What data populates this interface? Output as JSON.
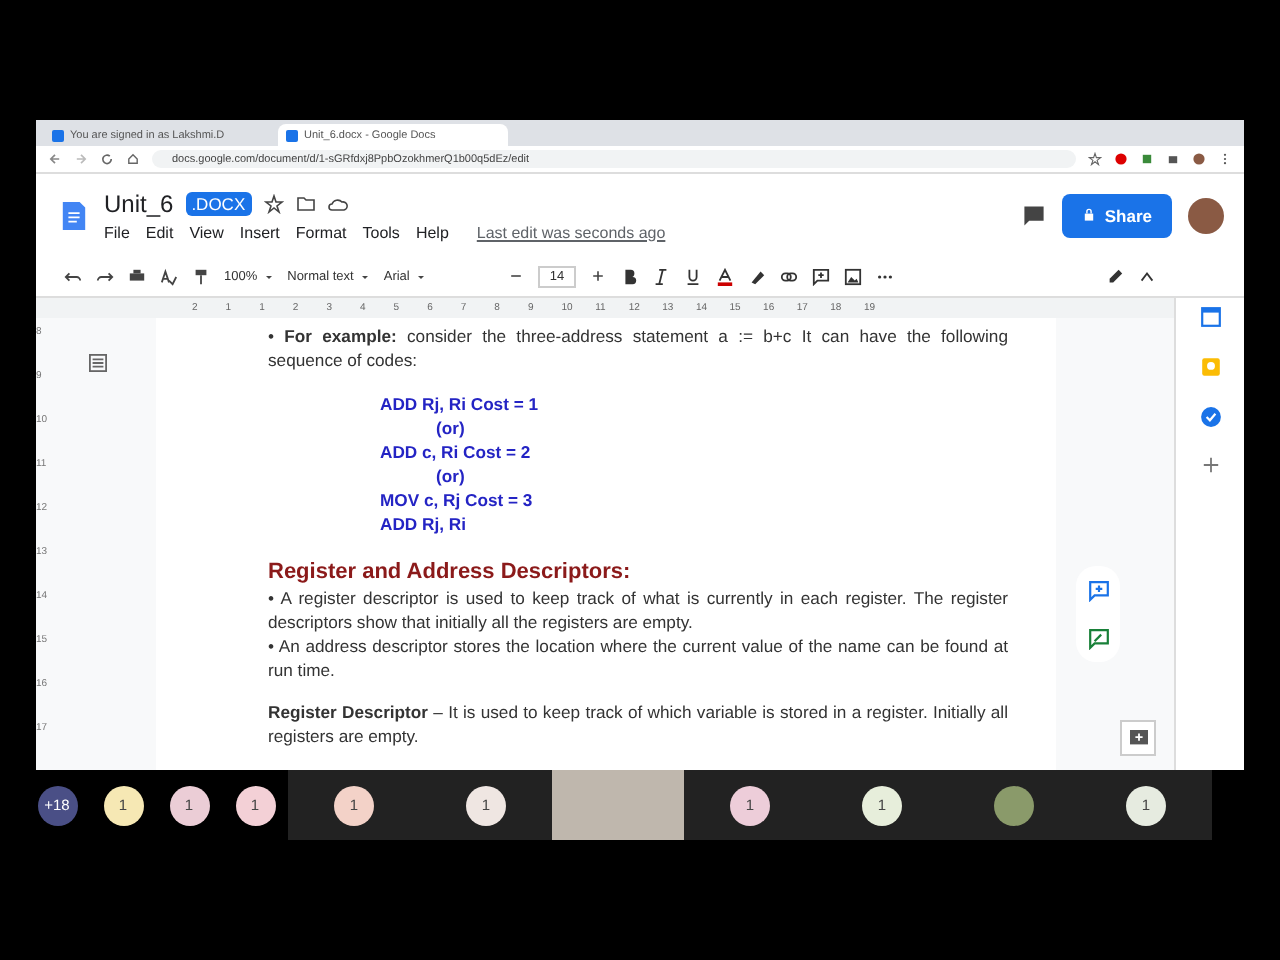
{
  "browser": {
    "tabs": [
      {
        "title": "You are signed in as Lakshmi.D",
        "selected": false
      },
      {
        "title": "Unit_6.docx - Google Docs",
        "selected": true
      }
    ],
    "url": "docs.google.com/document/d/1-sGRfdxj8PpbOzokhmerQ1b00q5dEz/edit"
  },
  "doc": {
    "title": "Unit_6",
    "badge": ".DOCX",
    "menus": [
      "File",
      "Edit",
      "View",
      "Insert",
      "Format",
      "Tools",
      "Help"
    ],
    "last_edit": "Last edit was seconds ago",
    "share": "Share"
  },
  "toolbar": {
    "zoom": "100%",
    "style": "Normal text",
    "font": "Arial",
    "size": "14"
  },
  "ruler": [
    "2",
    "1",
    "1",
    "2",
    "3",
    "4",
    "5",
    "6",
    "7",
    "8",
    "9",
    "10",
    "11",
    "12",
    "13",
    "14",
    "15",
    "16",
    "17",
    "18",
    "19"
  ],
  "vertical_ruler": [
    "8",
    "9",
    "10",
    "11",
    "12",
    "13",
    "14",
    "15",
    "16",
    "17"
  ],
  "content": [
    {
      "kind": "para",
      "text": "• **For example:** consider the three-address statement a := b+c It can have the following sequence of codes:"
    },
    {
      "kind": "code",
      "text": "ADD Rj, Ri Cost = 1",
      "indent": false
    },
    {
      "kind": "code",
      "text": "(or)",
      "indent": true
    },
    {
      "kind": "code",
      "text": "ADD c, Ri Cost = 2",
      "indent": false
    },
    {
      "kind": "code",
      "text": "(or)",
      "indent": true
    },
    {
      "kind": "code",
      "text": "MOV c, Rj Cost = 3",
      "indent": false
    },
    {
      "kind": "code",
      "text": "ADD Rj, Ri",
      "indent": false
    },
    {
      "kind": "heading",
      "text": "Register and Address Descriptors:"
    },
    {
      "kind": "para",
      "text": "• A register descriptor is used to keep track of what is currently in each register. The register descriptors show that initially all the registers are empty."
    },
    {
      "kind": "para",
      "text": "• An address descriptor stores the location where the current value of the name can be found at run time."
    },
    {
      "kind": "para",
      "text": "**Register Descriptor** – It is used to keep track of which variable is stored in a register. Initially all registers are empty."
    }
  ],
  "meeting": [
    {
      "kind": "count",
      "label": "+18",
      "color": "#4a4f86",
      "tile": false
    },
    {
      "kind": "initial",
      "label": "1",
      "color": "#f6e8b4",
      "tile": false
    },
    {
      "kind": "initial",
      "label": "1",
      "color": "#ebcdd6",
      "tile": false
    },
    {
      "kind": "initial",
      "label": "1",
      "color": "#f3d0d6",
      "tile": false
    },
    {
      "kind": "initial",
      "label": "1",
      "color": "#f3d2c8",
      "tile": true
    },
    {
      "kind": "initial",
      "label": "1",
      "color": "#efe6e2",
      "tile": true
    },
    {
      "kind": "video"
    },
    {
      "kind": "initial",
      "label": "1",
      "color": "#edcdd9",
      "tile": true
    },
    {
      "kind": "initial",
      "label": "1",
      "color": "#e7eedb",
      "tile": true
    },
    {
      "kind": "picture",
      "tile": true
    },
    {
      "kind": "initial",
      "label": "1",
      "color": "#e6ebe0",
      "tile": true
    }
  ]
}
